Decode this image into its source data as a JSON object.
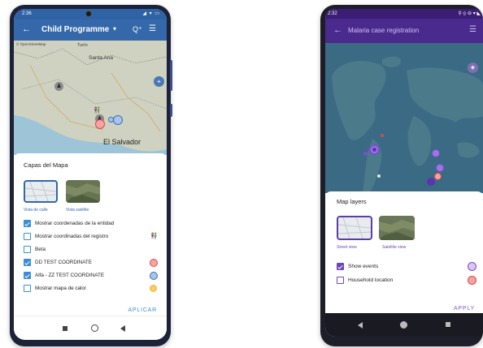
{
  "left_phone": {
    "status": {
      "time": "2:36",
      "icons": "◢ ▾ ▭"
    },
    "appbar": {
      "back": "←",
      "title": "Child Programme",
      "dropdown": "▾",
      "qr": "Q⁺",
      "filter": "☰"
    },
    "map": {
      "attribution": "© OpenStreetMap",
      "place_labels": [
        "Turín",
        "Santa Ana",
        "El Salvador"
      ],
      "compass": "⌖"
    },
    "sheet": {
      "title": "Capas del Mapa",
      "thumbnails": [
        "Vista de calle",
        "Vista satélite"
      ],
      "options": [
        {
          "label": "Mostrar coordenadas de la entidad",
          "checked": true
        },
        {
          "label": "Mostrar coordinadas del registro",
          "checked": false,
          "icon": "people-icon",
          "glyph": "👫"
        },
        {
          "label": "Beta",
          "checked": false
        },
        {
          "label": "DD TEST COORDINATE",
          "checked": true,
          "color": "#f5a3a3",
          "border": "#d94a4a"
        },
        {
          "label": "Alfa - ZZ TEST COORDINATE",
          "checked": true,
          "color": "#a8c4ea",
          "border": "#3b6fb8"
        },
        {
          "label": "Mostrar mapa de calor",
          "checked": false,
          "icon": "heatmap-icon"
        }
      ],
      "apply": "APLICAR"
    }
  },
  "right_phone": {
    "status": {
      "time": "2:32",
      "icons": "⚲ ⦸ ⊖ ▾ ◣"
    },
    "appbar": {
      "back": "←",
      "title": "Malaria case registration",
      "filter": "☰"
    },
    "sheet": {
      "title": "Map layers",
      "thumbnails": [
        "Street view",
        "Satellite view"
      ],
      "options": [
        {
          "label": "Show events",
          "checked": true,
          "color": "#d9c6f5",
          "border": "#7a4fd0"
        },
        {
          "label": "Household location",
          "checked": false,
          "color": "#f5a3a3",
          "border": "#d94a4a"
        }
      ],
      "apply": "APPLY"
    }
  }
}
